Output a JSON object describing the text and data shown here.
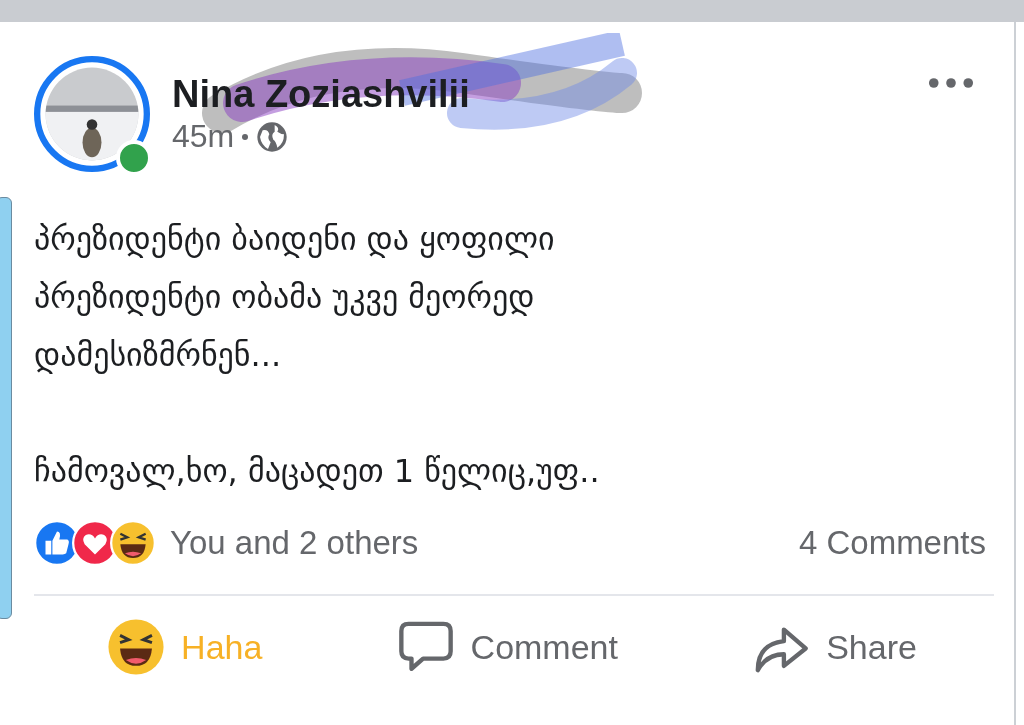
{
  "post": {
    "author": "Nina Zoziashvilii",
    "online": true,
    "time": "45m",
    "paragraphs": [
      [
        "პრეზიდენტი ბაიდენი და ყოფილი",
        "პრეზიდენტი ობამა უკვე მეორედ",
        "დამესიზმრნენ..."
      ],
      [
        "ჩამოვალ,ხო, მაცადეთ 1 წელიც,უფ.."
      ]
    ],
    "reactions_summary": "You and 2 others",
    "comments_count": "4 Comments",
    "actions": [
      {
        "kind": "haha",
        "label": "Haha",
        "active": true
      },
      {
        "kind": "comment",
        "label": "Comment",
        "active": false
      },
      {
        "kind": "share",
        "label": "Share",
        "active": false
      }
    ]
  }
}
